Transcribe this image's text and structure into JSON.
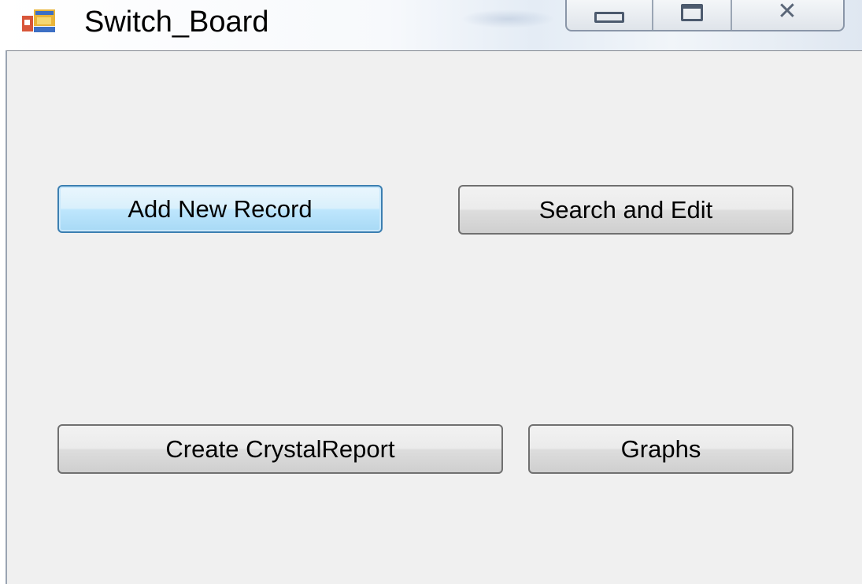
{
  "window": {
    "title": "Switch_Board",
    "icon": "winforms-app-icon",
    "caption_buttons": {
      "minimize": "minimize-icon",
      "maximize": "maximize-icon",
      "close": "close-icon"
    }
  },
  "buttons": {
    "add_new_record": "Add New Record",
    "search_and_edit": "Search and Edit",
    "create_crystal_report": "Create CrystalReport",
    "graphs": "Graphs"
  },
  "state": {
    "focused_button": "add_new_record"
  },
  "colors": {
    "client_background": "#f0f0f0",
    "focus_border": "#3c7fb1",
    "button_border": "#707070"
  }
}
